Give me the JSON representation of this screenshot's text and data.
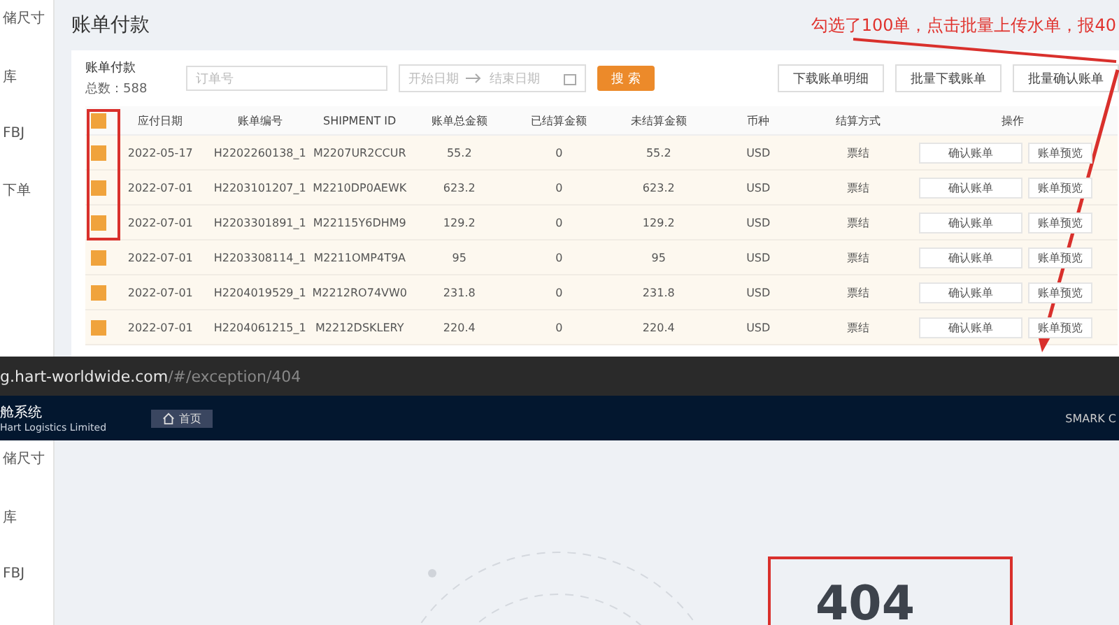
{
  "top_screen": {
    "sidebar_items": [
      "储尺寸",
      "库",
      "FBJ",
      "下单"
    ],
    "page_title": "账单付款",
    "annotation": "勾选了100单，点击批量上传水单，报40",
    "summary": {
      "title": "账单付款",
      "total": "总数：588"
    },
    "filters": {
      "order_placeholder": "订单号",
      "start_placeholder": "开始日期",
      "end_placeholder": "结束日期",
      "search_button": "搜 索"
    },
    "actions": [
      "下载账单明细",
      "批量下载账单",
      "批量确认账单"
    ],
    "table": {
      "all_checked": true,
      "columns": [
        "应付日期",
        "账单编号",
        "SHIPMENT ID",
        "账单总金额",
        "已结算金额",
        "未结算金额",
        "币种",
        "结算方式",
        "操作"
      ],
      "rows": [
        {
          "checked": true,
          "cells": [
            "2022-05-17",
            "H2202260138_1",
            "M2207UR2CCUR",
            "55.2",
            "0",
            "55.2",
            "USD",
            "票结"
          ],
          "buttons": [
            "确认账单",
            "账单预览"
          ]
        },
        {
          "checked": true,
          "cells": [
            "2022-07-01",
            "H2203101207_1",
            "M2210DP0AEWK",
            "623.2",
            "0",
            "623.2",
            "USD",
            "票结"
          ],
          "buttons": [
            "确认账单",
            "账单预览"
          ]
        },
        {
          "checked": true,
          "cells": [
            "2022-07-01",
            "H2203301891_1",
            "M22115Y6DHM9",
            "129.2",
            "0",
            "129.2",
            "USD",
            "票结"
          ],
          "buttons": [
            "确认账单",
            "账单预览"
          ]
        },
        {
          "checked": true,
          "cells": [
            "2022-07-01",
            "H2203308114_1",
            "M2211OMP4T9A",
            "95",
            "0",
            "95",
            "USD",
            "票结"
          ],
          "buttons": [
            "确认账单",
            "账单预览"
          ]
        },
        {
          "checked": true,
          "cells": [
            "2022-07-01",
            "H2204019529_1",
            "M2212RO74VW0",
            "231.8",
            "0",
            "231.8",
            "USD",
            "票结"
          ],
          "buttons": [
            "确认账单",
            "账单预览"
          ]
        },
        {
          "checked": true,
          "cells": [
            "2022-07-01",
            "H2204061215_1",
            "M2212DSKLERY",
            "220.4",
            "0",
            "220.4",
            "USD",
            "票结"
          ],
          "buttons": [
            "确认账单",
            "账单预览"
          ]
        }
      ]
    }
  },
  "bottom_screen": {
    "url_host": "g.hart-worldwide.com",
    "url_path": "/#/exception/404",
    "brand": "舱系统",
    "brand_sub": "Hart Logistics Limited",
    "home_tab": "首页",
    "user": "SMARK C",
    "sidebar_items": [
      "储尺寸",
      "库",
      "FBJ"
    ],
    "error_code": "404"
  }
}
